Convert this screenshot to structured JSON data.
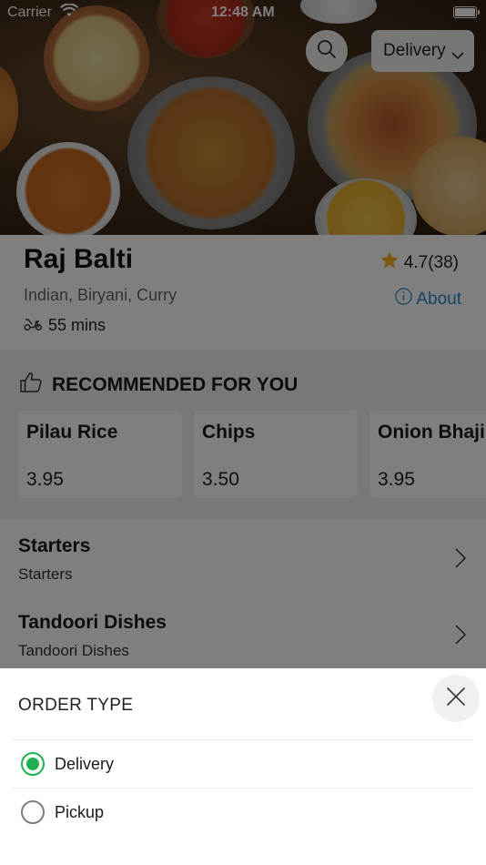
{
  "status_bar": {
    "carrier": "Carrier",
    "time": "12:48 AM"
  },
  "header": {
    "search_icon": "search-icon",
    "order_type_value": "Delivery"
  },
  "restaurant": {
    "name": "Raj Balti",
    "rating": "4.7",
    "rating_count": "(38)",
    "cuisines": "Indian, Biryani, Curry",
    "about_label": "About",
    "delivery_time": "55 mins"
  },
  "recommended": {
    "heading": "RECOMMENDED FOR YOU",
    "items": [
      {
        "name": "Pilau Rice",
        "price": "3.95"
      },
      {
        "name": "Chips",
        "price": "3.50"
      },
      {
        "name": "Onion Bhaji",
        "price": "3.95"
      }
    ]
  },
  "categories": [
    {
      "title": "Starters",
      "subtitle": "Starters"
    },
    {
      "title": "Tandoori Dishes",
      "subtitle": "Tandoori Dishes"
    }
  ],
  "order_sheet": {
    "title": "ORDER TYPE",
    "options": [
      {
        "label": "Delivery",
        "selected": true
      },
      {
        "label": "Pickup",
        "selected": false
      }
    ]
  },
  "colors": {
    "accent_green": "#20b050",
    "link_blue": "#2a89c9",
    "star": "#f2b01e"
  }
}
